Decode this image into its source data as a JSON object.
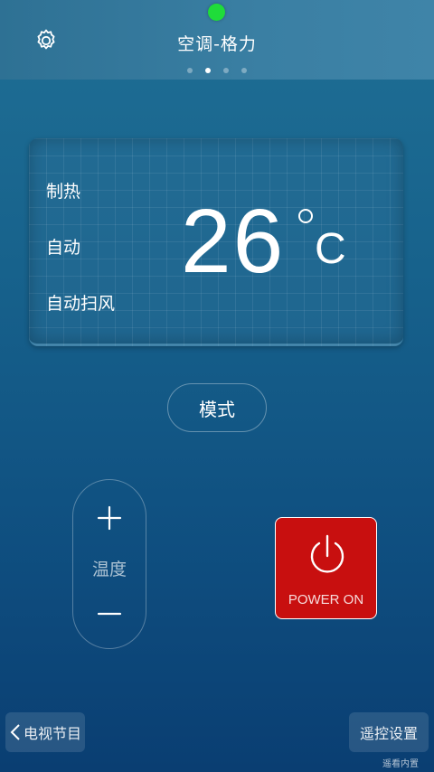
{
  "header": {
    "title": "空调-格力",
    "settings_icon": "gear-icon",
    "status_color": "#1fdc3a",
    "page_count": 4,
    "active_page": 2
  },
  "display": {
    "mode": "制热",
    "fan_speed": "自动",
    "swing": "自动扫风",
    "temperature": "26",
    "unit": "C"
  },
  "controls": {
    "mode_label": "模式",
    "temp_label": "温度",
    "increase_icon": "plus-icon",
    "decrease_icon": "minus-icon"
  },
  "power": {
    "label": "POWER ON",
    "icon": "power-icon",
    "color": "#c80f0f"
  },
  "footer": {
    "back_label": "电视节目",
    "settings_label": "遥控设置",
    "watermark": "遥看内置"
  }
}
